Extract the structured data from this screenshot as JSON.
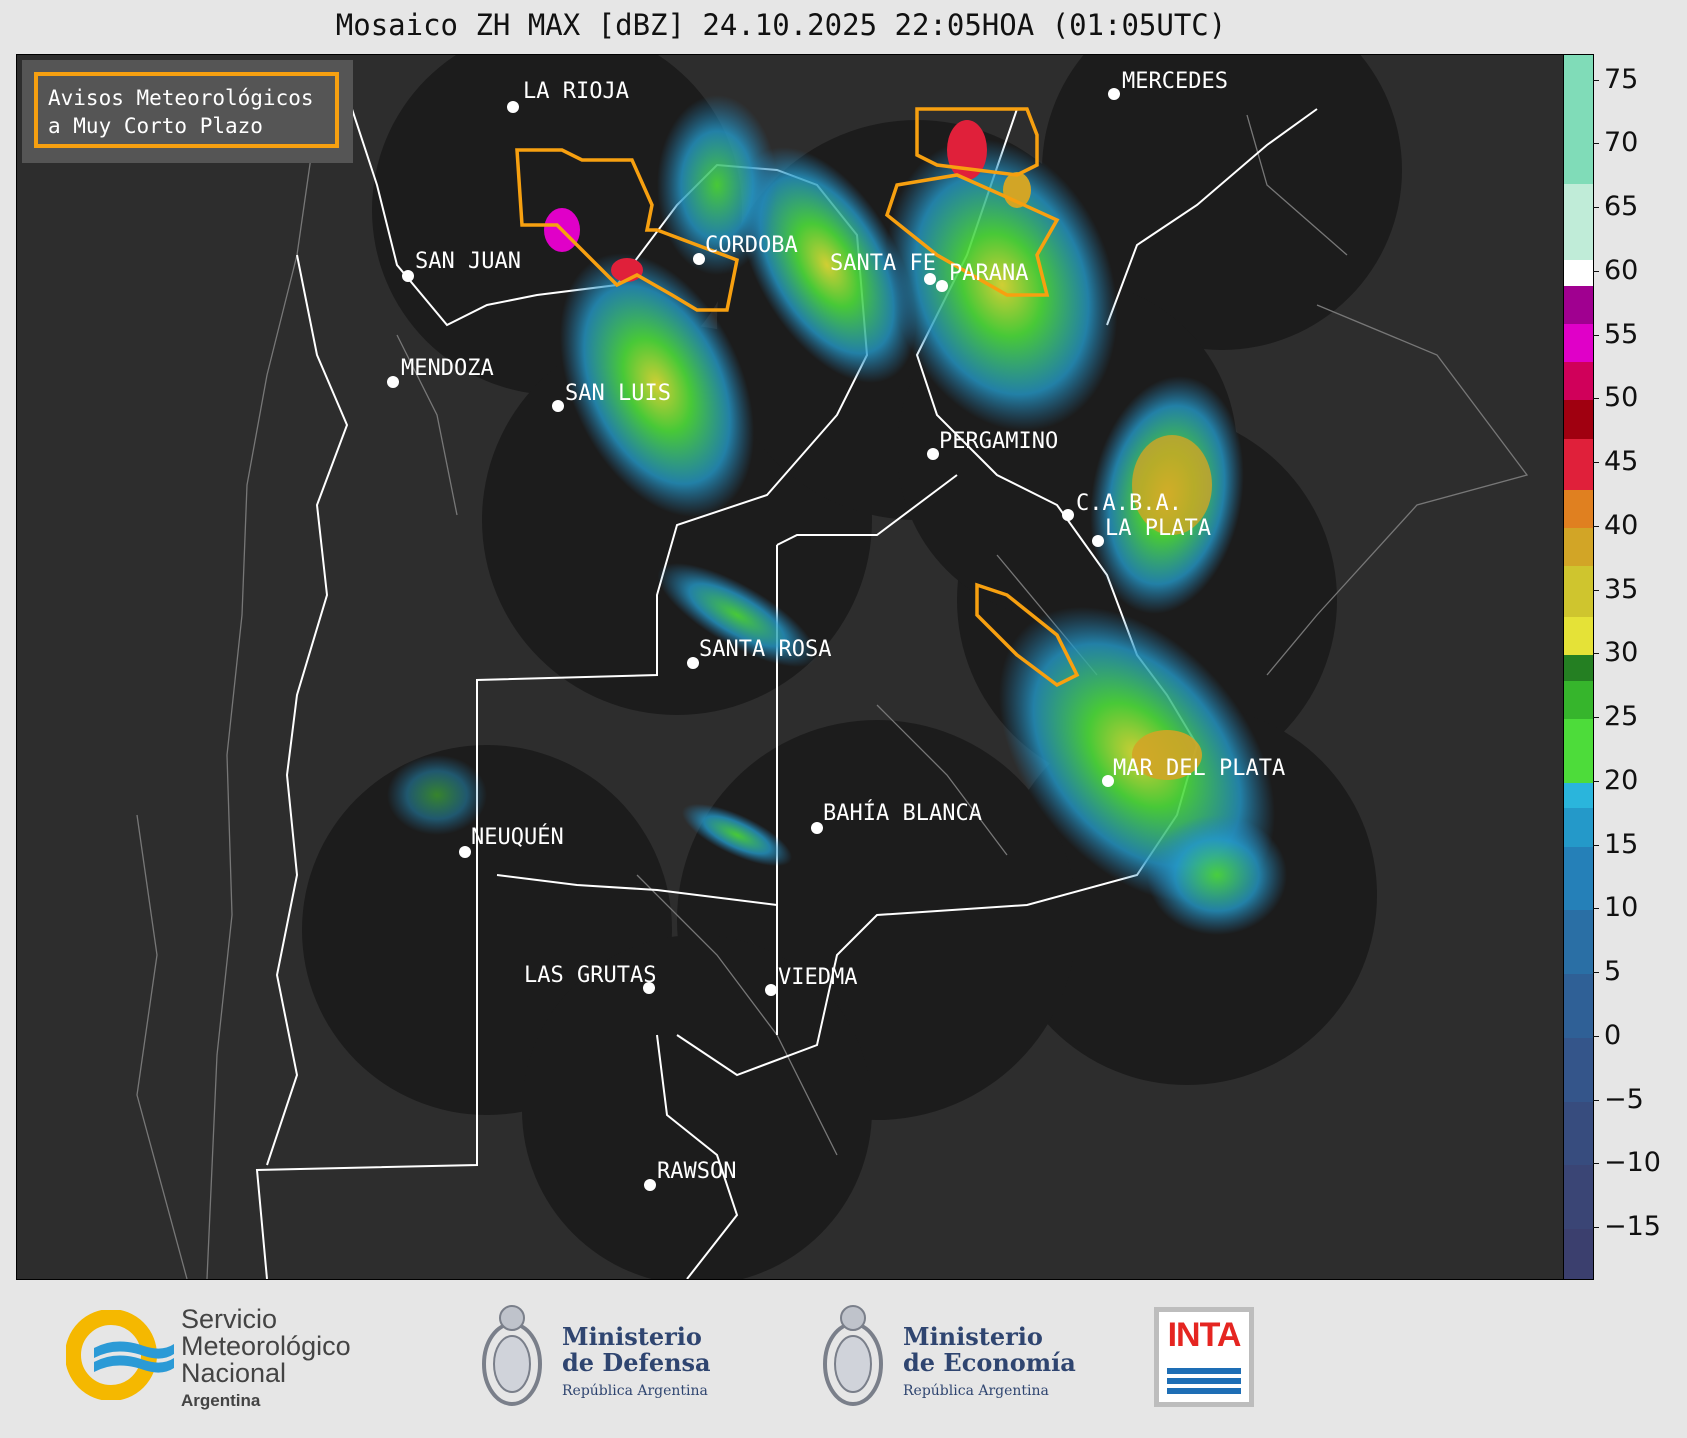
{
  "title": "Mosaico ZH MAX [dBZ] 24.10.2025 22:05HOA (01:05UTC)",
  "avisos": {
    "line1": "Avisos Meteorológicos",
    "line2": "a Muy Corto Plazo",
    "border_color": "#f7a010"
  },
  "colorbar": {
    "unit": "dBZ",
    "range": [
      -19,
      77
    ],
    "ticks": [
      {
        "value": 75,
        "label": "75"
      },
      {
        "value": 70,
        "label": "70"
      },
      {
        "value": 65,
        "label": "65"
      },
      {
        "value": 60,
        "label": "60"
      },
      {
        "value": 55,
        "label": "55"
      },
      {
        "value": 50,
        "label": "50"
      },
      {
        "value": 45,
        "label": "45"
      },
      {
        "value": 40,
        "label": "40"
      },
      {
        "value": 35,
        "label": "35"
      },
      {
        "value": 30,
        "label": "30"
      },
      {
        "value": 25,
        "label": "25"
      },
      {
        "value": 20,
        "label": "20"
      },
      {
        "value": 15,
        "label": "15"
      },
      {
        "value": 10,
        "label": "10"
      },
      {
        "value": 5,
        "label": "5"
      },
      {
        "value": 0,
        "label": "0"
      },
      {
        "value": -5,
        "label": "−5"
      },
      {
        "value": -10,
        "label": "−10"
      },
      {
        "value": -15,
        "label": "−15"
      }
    ],
    "bands": [
      {
        "from": -19,
        "to": -15,
        "color": "#3b3f6e"
      },
      {
        "from": -15,
        "to": -10,
        "color": "#3a4575"
      },
      {
        "from": -10,
        "to": -5,
        "color": "#374c7e"
      },
      {
        "from": -5,
        "to": 0,
        "color": "#34558a"
      },
      {
        "from": 0,
        "to": 5,
        "color": "#2f6096"
      },
      {
        "from": 5,
        "to": 10,
        "color": "#2a6fa5"
      },
      {
        "from": 10,
        "to": 15,
        "color": "#2580b8"
      },
      {
        "from": 15,
        "to": 18,
        "color": "#2499c9"
      },
      {
        "from": 18,
        "to": 20,
        "color": "#2ab5dc"
      },
      {
        "from": 20,
        "to": 25,
        "color": "#4ddc3a"
      },
      {
        "from": 25,
        "to": 28,
        "color": "#36b52c"
      },
      {
        "from": 28,
        "to": 30,
        "color": "#247f22"
      },
      {
        "from": 30,
        "to": 33,
        "color": "#e5e237"
      },
      {
        "from": 33,
        "to": 37,
        "color": "#cfc52e"
      },
      {
        "from": 37,
        "to": 40,
        "color": "#d2a526"
      },
      {
        "from": 40,
        "to": 43,
        "color": "#e08020"
      },
      {
        "from": 43,
        "to": 47,
        "color": "#e0203a"
      },
      {
        "from": 47,
        "to": 50,
        "color": "#a00010"
      },
      {
        "from": 50,
        "to": 53,
        "color": "#d0005a"
      },
      {
        "from": 53,
        "to": 56,
        "color": "#e000c8"
      },
      {
        "from": 56,
        "to": 59,
        "color": "#a00090"
      },
      {
        "from": 59,
        "to": 61,
        "color": "#ffffff"
      },
      {
        "from": 61,
        "to": 67,
        "color": "#c0ecd8"
      },
      {
        "from": 67,
        "to": 77,
        "color": "#80dcb8"
      }
    ]
  },
  "cities": [
    {
      "name": "LA RIOJA"
    },
    {
      "name": "MERCEDES"
    },
    {
      "name": "CORDOBA"
    },
    {
      "name": "SAN JUAN"
    },
    {
      "name": "SANTA FE"
    },
    {
      "name": "PARANA"
    },
    {
      "name": "MENDOZA"
    },
    {
      "name": "SAN LUIS"
    },
    {
      "name": "PERGAMINO"
    },
    {
      "name": "C.A.B.A."
    },
    {
      "name": "LA PLATA"
    },
    {
      "name": "SANTA ROSA"
    },
    {
      "name": "MAR DEL PLATA"
    },
    {
      "name": "BAHÍA BLANCA"
    },
    {
      "name": "NEUQUÉN"
    },
    {
      "name": "LAS GRUTAS"
    },
    {
      "name": "VIEDMA"
    },
    {
      "name": "RAWSON"
    }
  ],
  "footer": {
    "smn": {
      "line1": "Servicio",
      "line2": "Meteorológico",
      "line3": "Nacional",
      "line4": "Argentina"
    },
    "defensa": {
      "line1": "Ministerio",
      "line2": "de Defensa",
      "line3": "República Argentina"
    },
    "economia": {
      "line1": "Ministerio",
      "line2": "de Economía",
      "line3": "República Argentina"
    },
    "inta": {
      "text": "INTA"
    }
  }
}
